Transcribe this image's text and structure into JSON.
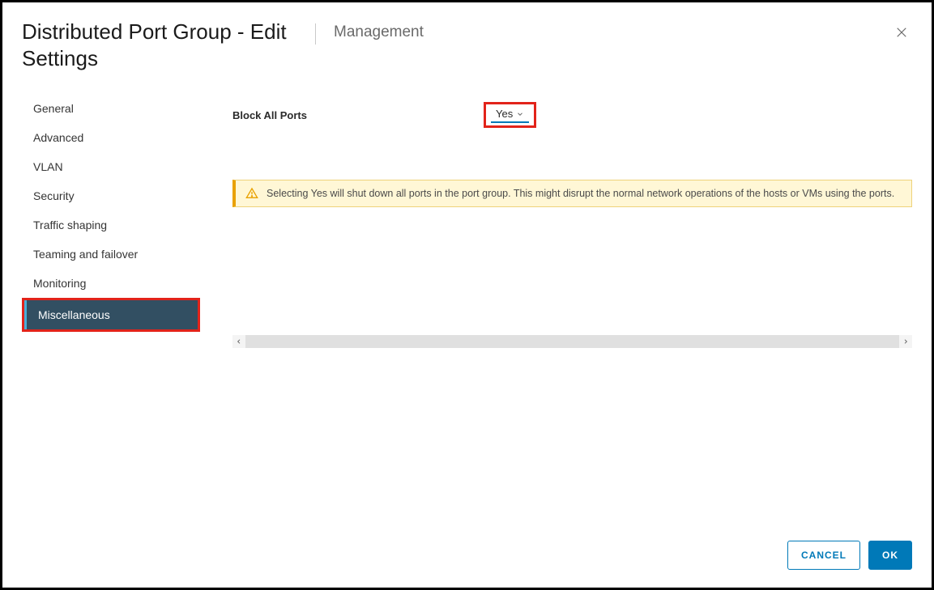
{
  "header": {
    "title": "Distributed Port Group - Edit Settings",
    "context": "Management"
  },
  "sidebar": {
    "items": [
      {
        "label": "General",
        "active": false
      },
      {
        "label": "Advanced",
        "active": false
      },
      {
        "label": "VLAN",
        "active": false
      },
      {
        "label": "Security",
        "active": false
      },
      {
        "label": "Traffic shaping",
        "active": false
      },
      {
        "label": "Teaming and failover",
        "active": false
      },
      {
        "label": "Monitoring",
        "active": false
      },
      {
        "label": "Miscellaneous",
        "active": true
      }
    ]
  },
  "main": {
    "block_all_ports_label": "Block All Ports",
    "block_all_ports_value": "Yes",
    "warning": "Selecting Yes will shut down all ports in the port group. This might disrupt the normal network operations of the hosts or VMs using the ports."
  },
  "footer": {
    "cancel": "CANCEL",
    "ok": "OK"
  }
}
